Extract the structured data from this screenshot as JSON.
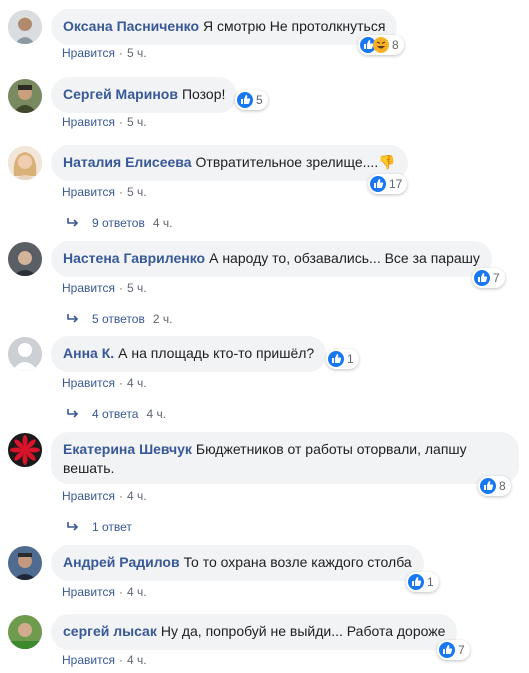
{
  "comments": [
    {
      "author": "Оксана Пасниченко",
      "text": "Я смотрю Не протолкнуться",
      "reactions": "8",
      "like": "Нравится",
      "time": "5 ч.",
      "avatar_color": "#b9c2c8"
    },
    {
      "author": "Сергей Маринов",
      "text": "Позор!",
      "reactions": "5",
      "like": "Нравится",
      "time": "5 ч.",
      "avatar_color": "#6b7a52"
    },
    {
      "author": "Наталия Елисеева",
      "text": "Отвратительное зрелище....👎",
      "reactions": "17",
      "like": "Нравится",
      "time": "5 ч.",
      "avatar_color": "#d8b899",
      "replies": "9 ответов",
      "replies_time": "4 ч."
    },
    {
      "author": "Настена Гавриленко",
      "text": "А народу то, обзавались... Все за парашу",
      "reactions": "7",
      "like": "Нравится",
      "time": "5 ч.",
      "avatar_color": "#4a4f57",
      "replies": "5 ответов",
      "replies_time": "2 ч."
    },
    {
      "author": "Анна К.",
      "text": "А на площадь кто-то пришёл?",
      "reactions": "1",
      "like": "Нравится",
      "time": "4 ч.",
      "avatar_color": "#ccd0d5",
      "replies": "4 ответа",
      "replies_time": "4 ч."
    },
    {
      "author": "Екатерина Шевчук",
      "text": "Бюджетников от работы оторвали, лапшу вешать.",
      "reactions": "8",
      "like": "Нравится",
      "time": "4 ч.",
      "avatar_color": "#c0182a",
      "replies": "1 ответ",
      "replies_time": ""
    },
    {
      "author": "Андрей Радилов",
      "text": "То то охрана возле каждого столба",
      "reactions": "1",
      "like": "Нравится",
      "time": "4 ч.",
      "avatar_color": "#3b4a6b"
    },
    {
      "author": "сергей лысак",
      "text": "Ну да, попробуй не выйди... Работа дороже",
      "reactions": "7",
      "like": "Нравится",
      "time": "4 ч.",
      "avatar_color": "#5d8a4a"
    }
  ],
  "colors": {
    "name": "#385898",
    "bubble": "#f2f3f5",
    "meta": "#606770",
    "like_blue": "#1877f2"
  }
}
